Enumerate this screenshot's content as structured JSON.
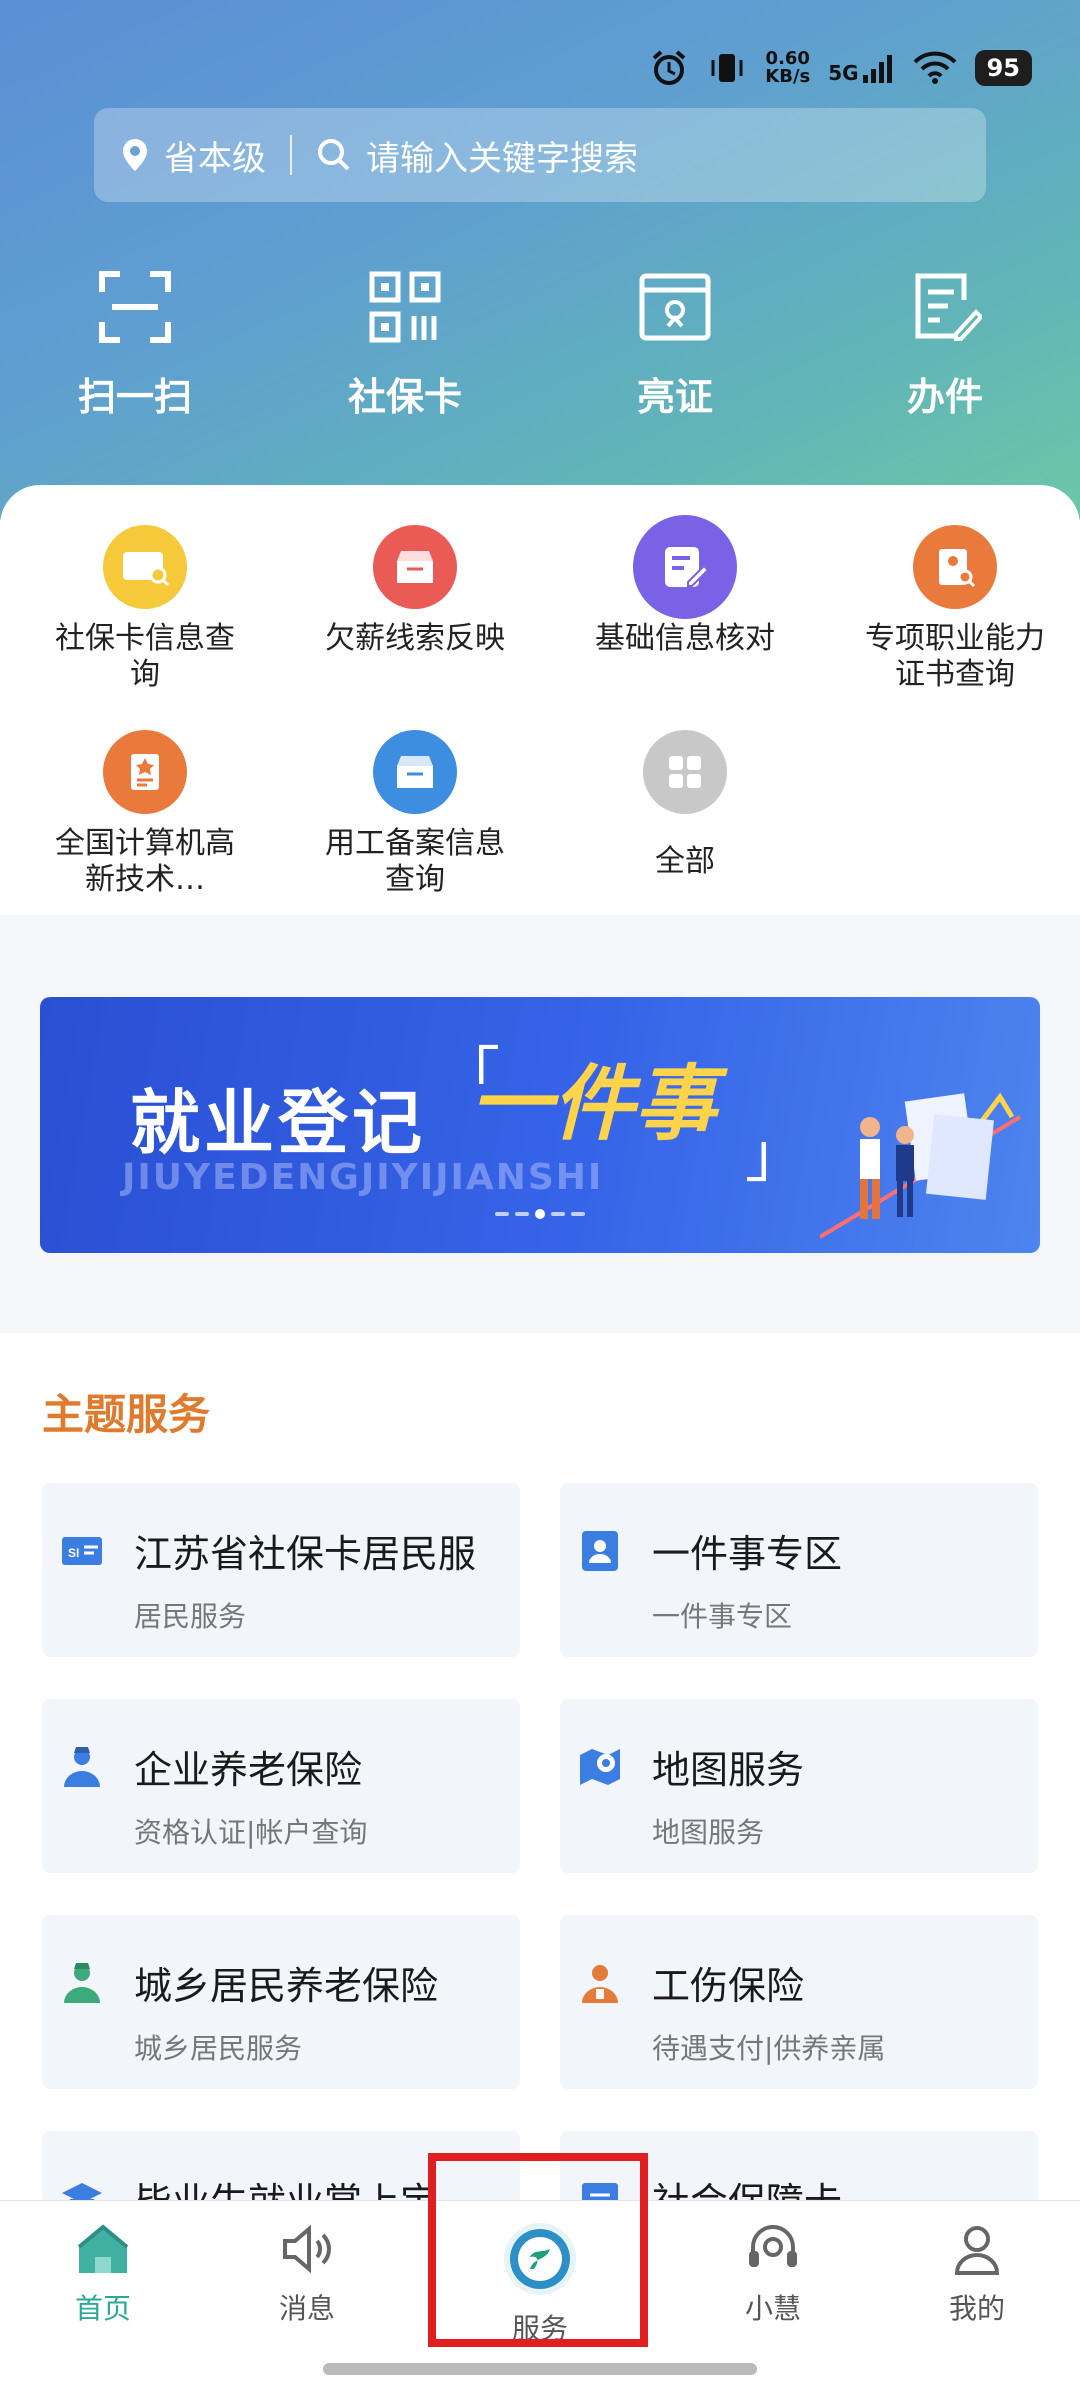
{
  "status": {
    "speed": "0.60",
    "speed_unit": "KB/s",
    "network": "5G",
    "battery": "95"
  },
  "search": {
    "location": "省本级",
    "placeholder": "请输入关键字搜索"
  },
  "quick_actions": [
    {
      "label": "扫一扫",
      "icon": "scan-icon"
    },
    {
      "label": "社保卡",
      "icon": "qr-code-icon"
    },
    {
      "label": "亮证",
      "icon": "certificate-icon"
    },
    {
      "label": "办件",
      "icon": "edit-document-icon"
    }
  ],
  "services": [
    {
      "label": "社保卡信息查询",
      "icon": "card-search-icon",
      "color": "#f5c93a"
    },
    {
      "label": "欠薪线索反映",
      "icon": "inbox-icon",
      "color": "#ea5b55"
    },
    {
      "label": "基础信息核对",
      "icon": "edit-note-icon",
      "color": "#7a62e6"
    },
    {
      "label": "专项职业能力证书查询",
      "icon": "certificate-search-icon",
      "color": "#ea7a3c"
    },
    {
      "label": "全国计算机高新技术…",
      "icon": "award-document-icon",
      "color": "#ea7a3c"
    },
    {
      "label": "用工备案信息查询",
      "icon": "inbox-icon",
      "color": "#3d8ee0"
    },
    {
      "label": "全部",
      "icon": "grid-icon",
      "color": "#c8c8c8"
    }
  ],
  "banner": {
    "main": "就业登记",
    "highlight": "一件事",
    "sub": "JIUYEDENGJIYIJIANSHI"
  },
  "theme": {
    "title": "主题服务",
    "cards": [
      {
        "title": "江苏省社保卡居民服",
        "subtitle": "居民服务",
        "icon": "si-card-icon"
      },
      {
        "title": "一件事专区",
        "subtitle": "一件事专区",
        "icon": "person-card-icon"
      },
      {
        "title": "企业养老保险",
        "subtitle": "资格认证|帐户查询",
        "icon": "enterprise-person-icon"
      },
      {
        "title": "地图服务",
        "subtitle": "地图服务",
        "icon": "map-pin-icon"
      },
      {
        "title": "城乡居民养老保险",
        "subtitle": "城乡居民服务",
        "icon": "resident-person-icon"
      },
      {
        "title": "工伤保险",
        "subtitle": "待遇支付|供养亲属",
        "icon": "worker-icon"
      },
      {
        "title": "毕业生就业掌上宝",
        "subtitle": "",
        "icon": "graduation-cap-icon"
      },
      {
        "title": "社会保障卡",
        "subtitle": "",
        "icon": "card-icon"
      }
    ]
  },
  "nav": [
    {
      "label": "首页",
      "icon": "home-icon",
      "active": true
    },
    {
      "label": "消息",
      "icon": "speaker-icon",
      "active": false
    },
    {
      "label": "服务",
      "icon": "service-logo-icon",
      "active": false
    },
    {
      "label": "小慧",
      "icon": "headset-icon",
      "active": false
    },
    {
      "label": "我的",
      "icon": "user-icon",
      "active": false
    }
  ]
}
